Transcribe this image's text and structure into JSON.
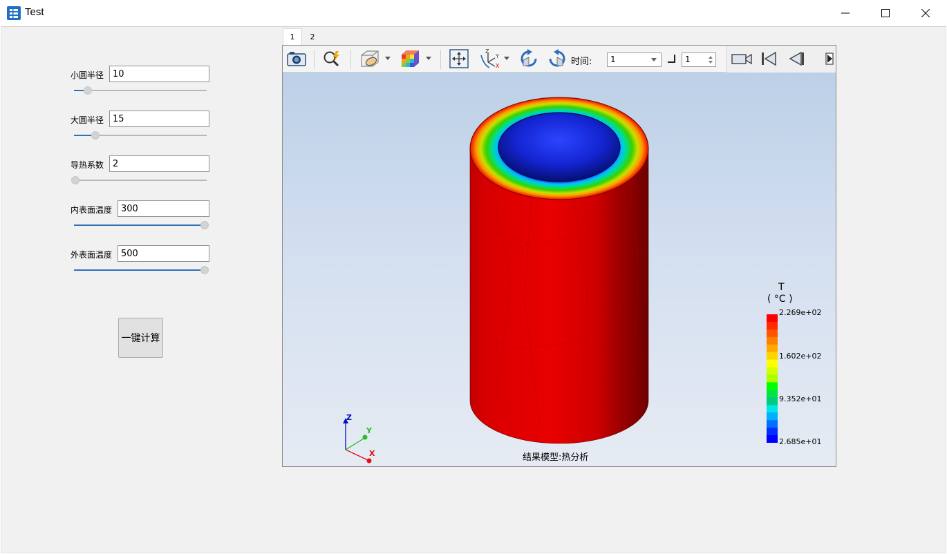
{
  "window": {
    "title": "Test",
    "icon": "table-app-icon",
    "controls": [
      "minimize-icon",
      "maximize-icon",
      "close-icon"
    ]
  },
  "params": [
    {
      "label": "小圆半径",
      "value": "10",
      "slider_fraction": 0.08
    },
    {
      "label": "大圆半径",
      "value": "15",
      "slider_fraction": 0.14
    },
    {
      "label": "导热系数",
      "value": "2",
      "slider_fraction": 0.0
    },
    {
      "label": "内表面温度",
      "value": "300",
      "slider_fraction": 1.0
    },
    {
      "label": "外表面温度",
      "value": "500",
      "slider_fraction": 1.0
    }
  ],
  "calc_button": "一键计算",
  "tabs": [
    {
      "label": "1",
      "active": true
    },
    {
      "label": "2",
      "active": false
    }
  ],
  "toolbar": {
    "icons": [
      "camera-icon",
      "magnify-icon",
      "clip-plane-icon",
      "color-cube-icon",
      "fit-view-icon",
      "axes-icon",
      "rotate-cw-icon",
      "rotate-ccw-icon"
    ],
    "time_label": "时间:",
    "time_value": "1",
    "step_value": "1",
    "playback_icons": [
      "record-camera-icon",
      "first-frame-icon",
      "prev-frame-icon",
      "next-frame-icon"
    ]
  },
  "legend": {
    "title": "T",
    "unit": "( °C )",
    "labels": [
      "2.269e+02",
      "1.602e+02",
      "9.352e+01",
      "2.685e+01"
    ],
    "colors_top_to_bottom": [
      "#ff0000",
      "#ff2a00",
      "#ff5500",
      "#ff8000",
      "#ffaa00",
      "#ffd500",
      "#ffff00",
      "#d4ff00",
      "#aaff00",
      "#00ff00",
      "#00e640",
      "#00cc80",
      "#00e5e5",
      "#00b0ff",
      "#0070ff",
      "#0030ff",
      "#0000ff"
    ]
  },
  "model_caption": "结果模型:热分析",
  "axes": {
    "x": "X",
    "y": "Y",
    "z": "Z"
  },
  "colors": {
    "accent": "#2f72b8",
    "cylinder_outer": "#d40000",
    "cylinder_inner": "#1626d8"
  }
}
